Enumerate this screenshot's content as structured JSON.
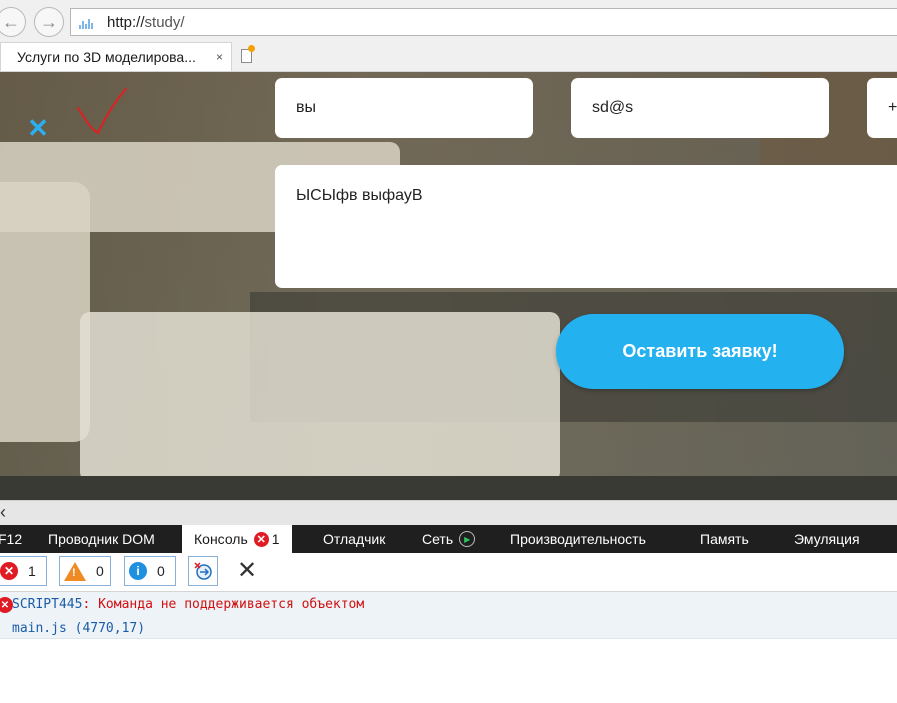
{
  "browser": {
    "url_scheme": "http://",
    "url_host": "study/",
    "tab_title": "Услуги по 3D моделирова...",
    "tab_close": "×"
  },
  "form": {
    "name_value": "вы",
    "email_value": "sd@s",
    "phone_value": "+",
    "message_value": "ЫСЫфв выфауВ",
    "submit_label": "Оставить заявку!",
    "close_glyph": "✕",
    "accent_color": "#24b1ef"
  },
  "devtools": {
    "tabs": [
      {
        "label": "F12"
      },
      {
        "label": "Проводник DOM"
      },
      {
        "label": "Консоль",
        "badge": "1"
      },
      {
        "label": "Отладчик"
      },
      {
        "label": "Сеть"
      },
      {
        "label": "Производительность"
      },
      {
        "label": "Память"
      },
      {
        "label": "Эмуляция"
      }
    ],
    "filters": {
      "errors": "1",
      "warnings": "0",
      "info": "0"
    },
    "message": {
      "code": "SCRIPT445",
      "text": ": Команда не поддерживается объектом",
      "source": "main.js (4770,17)"
    }
  },
  "annotations": {
    "check_color": "#e02020"
  }
}
